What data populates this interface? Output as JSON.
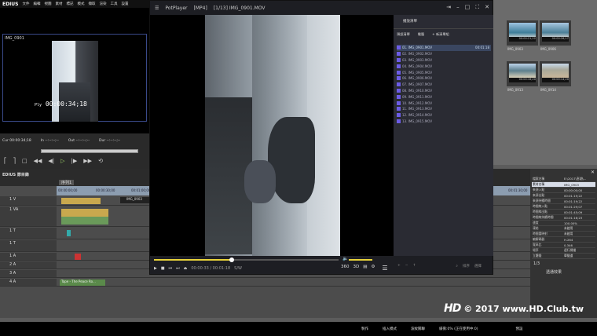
{
  "edius": {
    "logo": "EDIUS",
    "menu": [
      "文件",
      "編輯",
      "視圖",
      "素材",
      "標記",
      "模式",
      "擷取",
      "渲染",
      "工具",
      "設置",
      "幫助"
    ],
    "preview_label": "IMG_0901",
    "timecode_prefix": "Ply",
    "timecode": "00:00:34;18",
    "cur_label": "Cur 00:00:34;18",
    "in_label": "In --:--:--;--",
    "out_label": "Out --:--:--;--",
    "dur_label": "Dur --:--:--;--",
    "panel_title": "EDIUS 節目錄",
    "sequence_tab": "序列1",
    "tracks": [
      "1 V",
      "1 VA",
      "1 T",
      "1 T",
      "1 A",
      "2 A",
      "3 A",
      "4 A"
    ],
    "clip_label": "IMG_0903",
    "title_clip": "Tape - The Peace Ro...",
    "ruler_marks": [
      "00:00:00;00",
      "00:00:30;00",
      "00:01:00;00",
      "00:01:30;00"
    ]
  },
  "bin": {
    "items": [
      {
        "name": "IMG_0903",
        "duration": "00:00:21;22"
      },
      {
        "name": "IMG_0906",
        "duration": "00:00:26;17"
      },
      {
        "name": "IMG_0913",
        "duration": "00:00:16;20"
      },
      {
        "name": "IMG_0914",
        "duration": "00:00:14;20"
      }
    ]
  },
  "info": {
    "rows": [
      [
        "檔案名稱",
        "E:\\2017\\澎湖\\..."
      ],
      [
        "素材名稱",
        "IMG_0903"
      ],
      [
        "來源入點",
        "00:00:00;00"
      ],
      [
        "來源出點",
        "00:01:19;22"
      ],
      [
        "來源持續時間",
        "00:01:19;22"
      ],
      [
        "時間線入點",
        "00:01:29;07"
      ],
      [
        "時間線出點",
        "00:01:45;09"
      ],
      [
        "時間線持續時間",
        "00:01:16;23"
      ],
      [
        "速度",
        "100.00%"
      ],
      [
        "凍結",
        "未啟用"
      ],
      [
        "時間重映射",
        "未啟用"
      ],
      [
        "編解碼器",
        "H.264"
      ],
      [
        "寬高比",
        "0.346"
      ],
      [
        "場序",
        "逐行掃描"
      ],
      [
        "立體聲",
        "單聲道"
      ]
    ],
    "bottom_label": "1/3",
    "bottom_tab": "透通效果"
  },
  "status": [
    "製作",
    "插入模式",
    "波紋關聯",
    "緩衝:0% (正在使用中:0)"
  ],
  "status_right": "預設",
  "watermark": {
    "logo": "HD CLUB",
    "text": "© 2017 www.HD.Club.tw"
  },
  "potplayer": {
    "app": "PotPlayer",
    "format": "[MP4]",
    "title": "[1/13] IMG_0901.MOV",
    "tabs": [
      "播放清單"
    ],
    "subtabs": [
      "預設清單",
      "電腦",
      "+ 新清單組"
    ],
    "playlist": [
      {
        "name": "01. IMG_0901.MOV",
        "duration": "00:01:18"
      },
      {
        "name": "02. IMG_0902.MOV"
      },
      {
        "name": "03. IMG_0903.MOV"
      },
      {
        "name": "04. IMG_0904.MOV"
      },
      {
        "name": "05. IMG_0905.MOV"
      },
      {
        "name": "06. IMG_0906.MOV"
      },
      {
        "name": "07. IMG_0907.MOV"
      },
      {
        "name": "08. IMG_0910.MOV"
      },
      {
        "name": "09. IMG_0911.MOV"
      },
      {
        "name": "10. IMG_0912.MOV"
      },
      {
        "name": "11. IMG_0913.MOV"
      },
      {
        "name": "12. IMG_0914.MOV"
      },
      {
        "name": "13. IMG_0915.MOV"
      }
    ],
    "time": "00:00:33 / 00:01:18",
    "codec": "S/W",
    "seek_fraction": 0.42,
    "volume_fraction": 0.9,
    "pl_buttons": [
      "排序",
      "選擇"
    ],
    "accent": "#e8d23a"
  }
}
